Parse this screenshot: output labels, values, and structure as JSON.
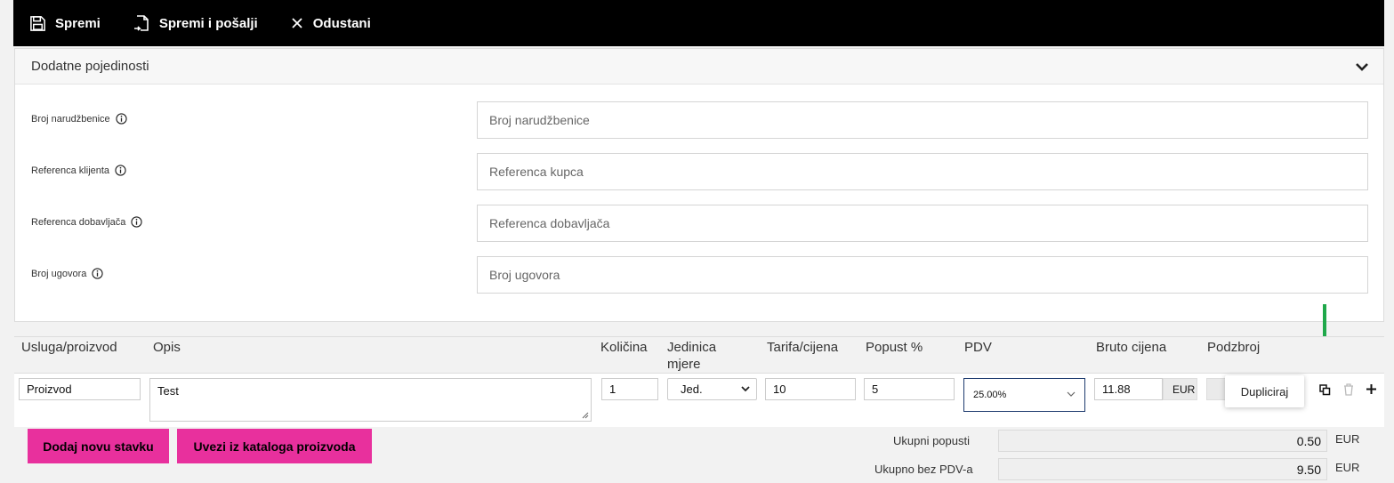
{
  "toolbar": {
    "save_label": "Spremi",
    "save_send_label": "Spremi i pošalji",
    "cancel_label": "Odustani"
  },
  "details": {
    "title": "Dodatne pojedinosti",
    "fields": [
      {
        "label": "Broj narudžbenice",
        "placeholder": "Broj narudžbenice"
      },
      {
        "label": "Referenca klijenta",
        "placeholder": "Referenca kupca"
      },
      {
        "label": "Referenca dobavljača",
        "placeholder": "Referenca dobavljača"
      },
      {
        "label": "Broj ugovora",
        "placeholder": "Broj ugovora"
      }
    ]
  },
  "items": {
    "headers": [
      "Usluga/proizvod",
      "Opis",
      "Količina",
      "Jedinica mjere",
      "Tarifa/cijena",
      "Popust %",
      "PDV",
      "Bruto cijena",
      "Podzbroj"
    ],
    "row": {
      "product": "Proizvod",
      "description": "Test",
      "quantity": "1",
      "unit": "Jed.",
      "price": "10",
      "discount": "5",
      "vat": "25.00%",
      "gross": "11.88",
      "currency": "EUR"
    },
    "tooltip": "Dupliciraj"
  },
  "actions": {
    "add_item": "Dodaj novu stavku",
    "import_catalog": "Uvezi iz kataloga proizvoda"
  },
  "summary": {
    "discounts_label": "Ukupni popusti",
    "discounts_value": "0.50",
    "net_label": "Ukupno bez PDV-a",
    "net_value": "9.50",
    "currency": "EUR"
  },
  "colors": {
    "accent": "#e8309d",
    "arrow": "#1fa84a",
    "toolbar": "#000000"
  }
}
